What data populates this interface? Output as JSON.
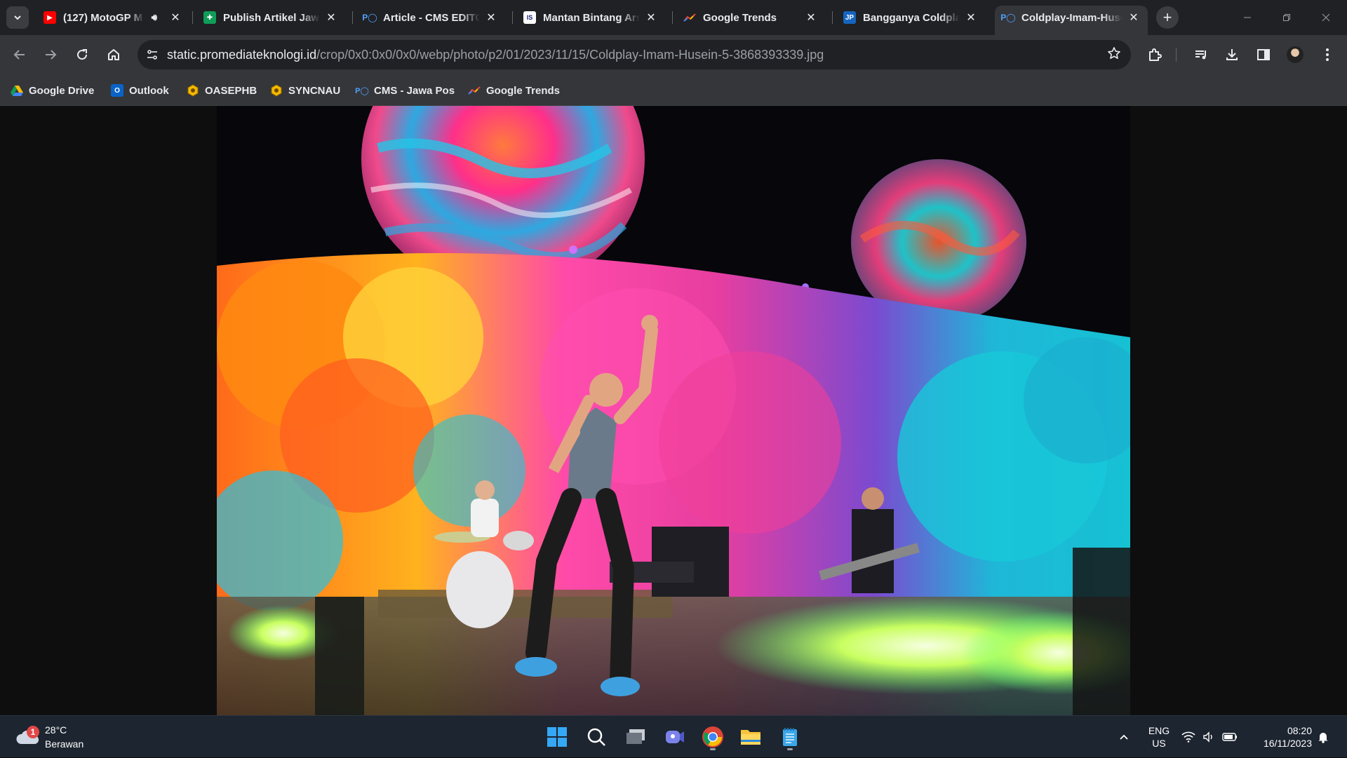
{
  "browser": {
    "tabs": [
      {
        "title": "(127) MotoGP M",
        "favicon": "youtube-icon",
        "color": "#ff0000",
        "muted_audio": true
      },
      {
        "title": "Publish Artikel Jawa",
        "favicon": "sheets-icon",
        "color": "#0f9d58"
      },
      {
        "title": "Article - CMS EDITOR",
        "favicon": "po-icon",
        "color": "#1a73e8"
      },
      {
        "title": "Mantan Bintang Arse",
        "favicon": "news-icon",
        "color": "#ffffff"
      },
      {
        "title": "Google Trends",
        "favicon": "trends-icon",
        "color": "#ea4335"
      },
      {
        "title": "Bangganya Coldplay",
        "favicon": "jp-icon",
        "color": "#1565c0"
      },
      {
        "title": "Coldplay-Imam-Husein",
        "favicon": "po-icon",
        "color": "#1a73e8",
        "active": true
      }
    ],
    "url_host": "static.promediateknologi.id",
    "url_path": "/crop/0x0:0x0/0x0/webp/photo/p2/01/2023/11/15/Coldplay-Imam-Husein-5-3868393339.jpg",
    "bookmarks": [
      {
        "label": "Google Drive",
        "icon": "drive-icon"
      },
      {
        "label": "Outlook",
        "icon": "outlook-icon"
      },
      {
        "label": "OASEPHB",
        "icon": "hexagon-icon"
      },
      {
        "label": "SYNCNAU",
        "icon": "hexagon-icon"
      },
      {
        "label": "CMS - Jawa Pos",
        "icon": "po-icon"
      },
      {
        "label": "Google Trends",
        "icon": "trends-icon"
      }
    ]
  },
  "taskbar": {
    "weather_temp": "28°C",
    "weather_desc": "Berawan",
    "weather_badge": "1",
    "lang_line1": "ENG",
    "lang_line2": "US",
    "time": "08:20",
    "date": "16/11/2023"
  },
  "colors": {
    "tab_strip": "#202124",
    "toolbar": "#35363a",
    "taskbar": "#1c2530"
  }
}
